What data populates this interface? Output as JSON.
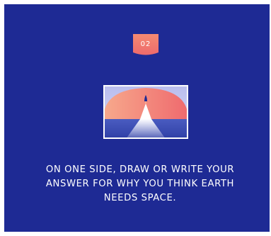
{
  "step": {
    "number": "02",
    "badge_color": "#f0746c"
  },
  "illustration": {
    "icon": "rocket-launch-icon",
    "colors": {
      "background": "#1e2a94",
      "sky": "#c2c6f0",
      "planet": "#f48676",
      "sea": "#3a4bad",
      "border": "#ffffff"
    }
  },
  "instruction": {
    "text": "ON ONE SIDE, DRAW OR WRITE YOUR ANSWER FOR WHY YOU THINK EARTH NEEDS SPACE."
  }
}
